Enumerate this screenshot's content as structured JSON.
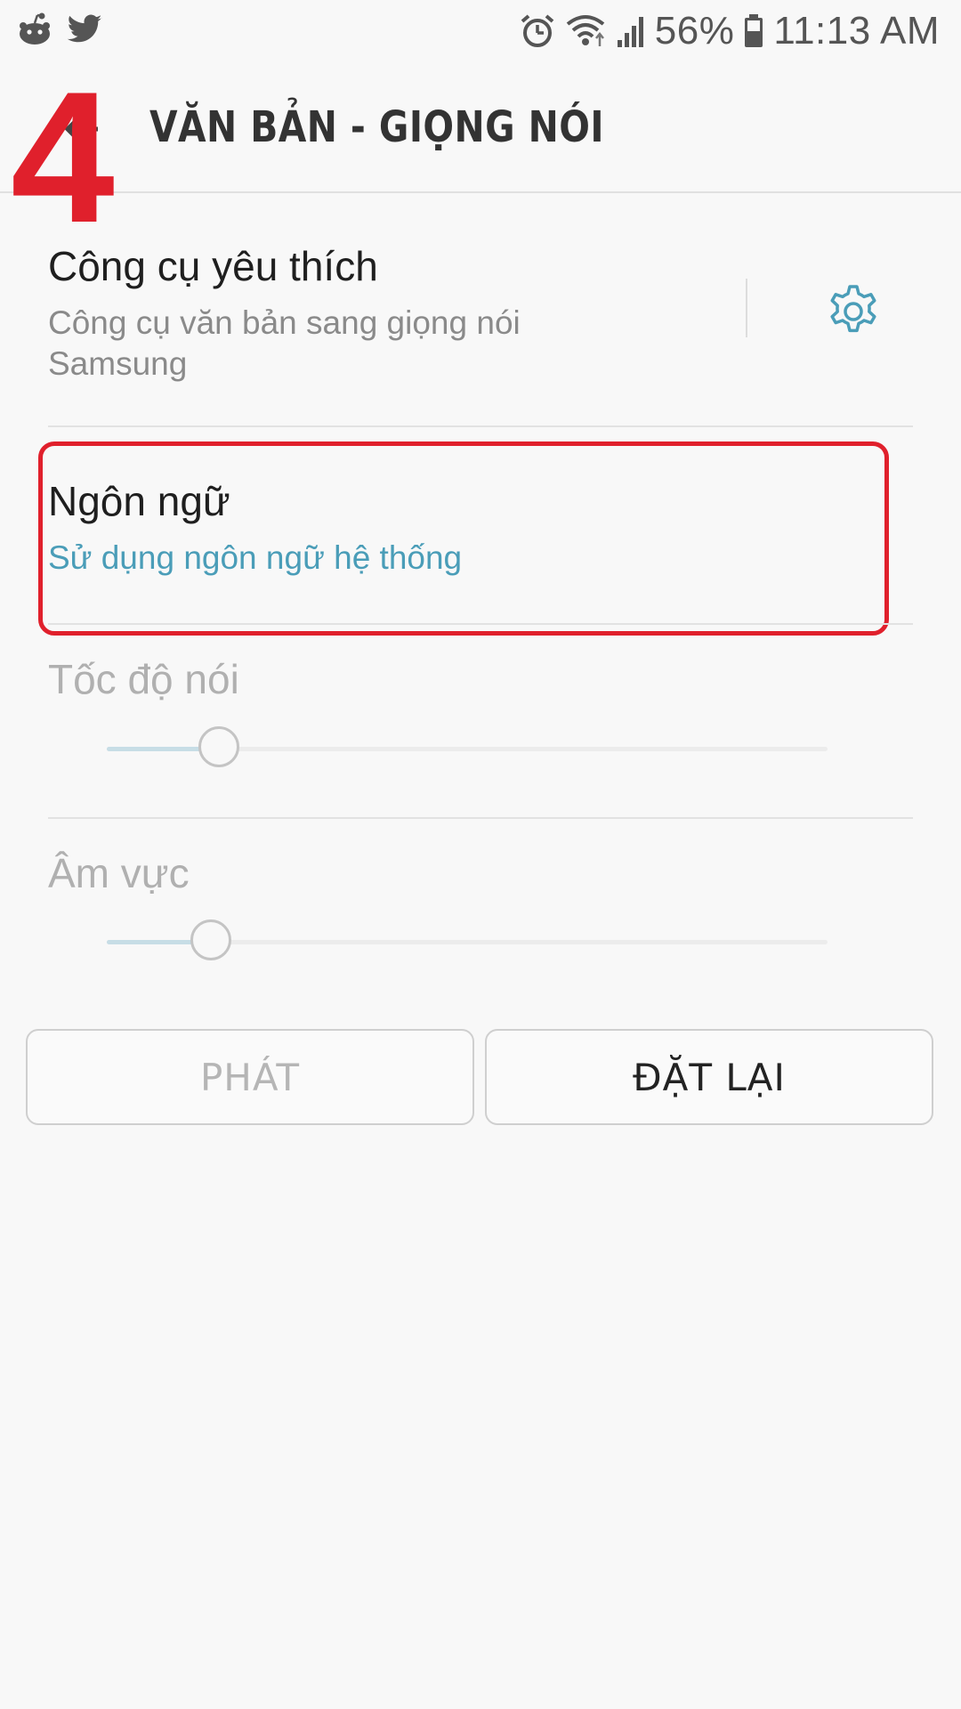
{
  "status_bar": {
    "battery": "56%",
    "time": "11:13 AM",
    "icons": [
      "reddit-icon",
      "twitter-icon",
      "alarm-icon",
      "wifi-icon",
      "signal-icon",
      "battery-icon"
    ]
  },
  "annotation": {
    "step_number": "4",
    "color": "#e0202c"
  },
  "header": {
    "title": "VĂN BẢN - GIỌNG NÓI"
  },
  "settings": {
    "engine": {
      "title": "Công cụ yêu thích",
      "subtitle": "Công cụ văn bản sang giọng nói Samsung",
      "accent": "#4a9db8"
    },
    "language": {
      "title": "Ngôn ngữ",
      "subtitle": "Sử dụng ngôn ngữ hệ thống"
    },
    "speech_rate": {
      "title": "Tốc độ nói",
      "level": 0.155
    },
    "pitch": {
      "title": "Âm vực",
      "level": 0.145
    }
  },
  "buttons": {
    "play": "PHÁT",
    "reset": "ĐẶT LẠI"
  }
}
